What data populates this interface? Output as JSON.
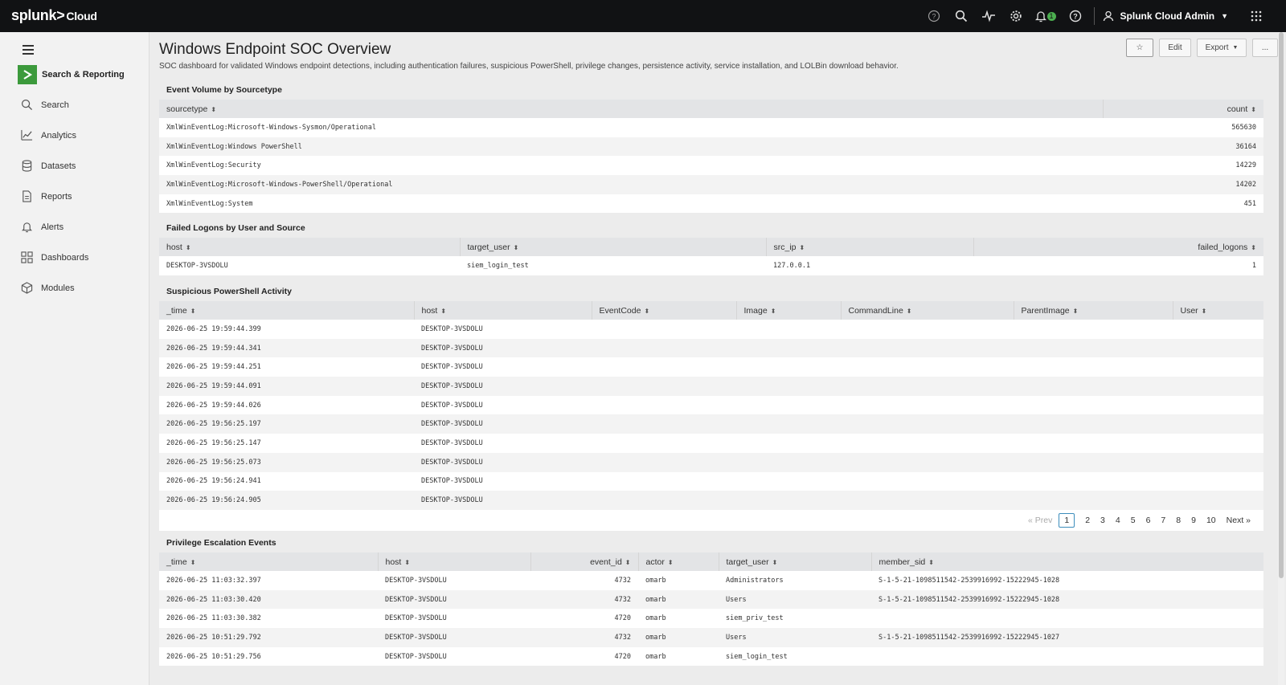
{
  "topbar": {
    "logo_text": "splunk>",
    "logo_suffix": "Cloud",
    "notification_count": "1",
    "user_name": "Splunk Cloud Admin"
  },
  "sidebar": {
    "app_name": "Search & Reporting",
    "items": [
      {
        "label": "Search",
        "icon": "search-icon"
      },
      {
        "label": "Analytics",
        "icon": "analytics-icon"
      },
      {
        "label": "Datasets",
        "icon": "datasets-icon"
      },
      {
        "label": "Reports",
        "icon": "reports-icon"
      },
      {
        "label": "Alerts",
        "icon": "alerts-icon"
      },
      {
        "label": "Dashboards",
        "icon": "dashboards-icon"
      },
      {
        "label": "Modules",
        "icon": "modules-icon"
      }
    ]
  },
  "dashboard": {
    "title": "Windows Endpoint SOC Overview",
    "description": "SOC dashboard for validated Windows endpoint detections, including authentication failures, suspicious PowerShell, privilege changes, persistence activity, service installation, and LOLBin download behavior.",
    "buttons": {
      "edit": "Edit",
      "export": "Export",
      "more": "..."
    }
  },
  "panels": {
    "volume": {
      "title": "Event Volume by Sourcetype",
      "columns": [
        "sourcetype",
        "count"
      ],
      "rows": [
        [
          "XmlWinEventLog:Microsoft-Windows-Sysmon/Operational",
          "565630"
        ],
        [
          "XmlWinEventLog:Windows PowerShell",
          "36164"
        ],
        [
          "XmlWinEventLog:Security",
          "14229"
        ],
        [
          "XmlWinEventLog:Microsoft-Windows-PowerShell/Operational",
          "14202"
        ],
        [
          "XmlWinEventLog:System",
          "451"
        ]
      ]
    },
    "failed": {
      "title": "Failed Logons by User and Source",
      "columns": [
        "host",
        "target_user",
        "src_ip",
        "failed_logons"
      ],
      "rows": [
        [
          "DESKTOP-3VSDOLU",
          "siem_login_test",
          "127.0.0.1",
          "1"
        ]
      ]
    },
    "powershell": {
      "title": "Suspicious PowerShell Activity",
      "columns": [
        "_time",
        "host",
        "EventCode",
        "Image",
        "CommandLine",
        "ParentImage",
        "User"
      ],
      "rows": [
        [
          "2026-06-25 19:59:44.399",
          "DESKTOP-3VSDOLU"
        ],
        [
          "2026-06-25 19:59:44.341",
          "DESKTOP-3VSDOLU"
        ],
        [
          "2026-06-25 19:59:44.251",
          "DESKTOP-3VSDOLU"
        ],
        [
          "2026-06-25 19:59:44.091",
          "DESKTOP-3VSDOLU"
        ],
        [
          "2026-06-25 19:59:44.026",
          "DESKTOP-3VSDOLU"
        ],
        [
          "2026-06-25 19:56:25.197",
          "DESKTOP-3VSDOLU"
        ],
        [
          "2026-06-25 19:56:25.147",
          "DESKTOP-3VSDOLU"
        ],
        [
          "2026-06-25 19:56:25.073",
          "DESKTOP-3VSDOLU"
        ],
        [
          "2026-06-25 19:56:24.941",
          "DESKTOP-3VSDOLU"
        ],
        [
          "2026-06-25 19:56:24.905",
          "DESKTOP-3VSDOLU"
        ]
      ],
      "pager": {
        "prev": "« Prev",
        "pages": [
          "1",
          "2",
          "3",
          "4",
          "5",
          "6",
          "7",
          "8",
          "9",
          "10"
        ],
        "current": "1",
        "next": "Next »"
      }
    },
    "privesc": {
      "title": "Privilege Escalation Events",
      "columns": [
        "_time",
        "host",
        "event_id",
        "actor",
        "target_user",
        "member_sid"
      ],
      "rows": [
        [
          "2026-06-25 11:03:32.397",
          "DESKTOP-3VSDOLU",
          "4732",
          "omarb",
          "Administrators",
          "S-1-5-21-1098511542-2539916992-15222945-1028"
        ],
        [
          "2026-06-25 11:03:30.420",
          "DESKTOP-3VSDOLU",
          "4732",
          "omarb",
          "Users",
          "S-1-5-21-1098511542-2539916992-15222945-1028"
        ],
        [
          "2026-06-25 11:03:30.382",
          "DESKTOP-3VSDOLU",
          "4720",
          "omarb",
          "siem_priv_test",
          ""
        ],
        [
          "2026-06-25 10:51:29.792",
          "DESKTOP-3VSDOLU",
          "4732",
          "omarb",
          "Users",
          "S-1-5-21-1098511542-2539916992-15222945-1027"
        ],
        [
          "2026-06-25 10:51:29.756",
          "DESKTOP-3VSDOLU",
          "4720",
          "omarb",
          "siem_login_test",
          ""
        ]
      ]
    }
  }
}
